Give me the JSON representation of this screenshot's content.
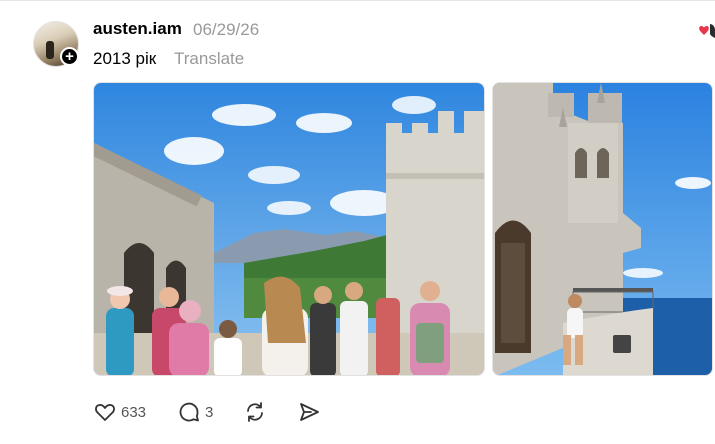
{
  "post": {
    "username": "austen.iam",
    "date": "06/29/26",
    "text": "2013 рік",
    "translate_label": "Translate",
    "follow_badge": "+"
  },
  "actions": {
    "likes": "633",
    "comments": "3"
  },
  "icons": {
    "like": "heart-icon",
    "comment": "comment-icon",
    "repost": "repost-icon",
    "share": "share-icon",
    "follow": "plus-icon",
    "top_right": "heart-reaction-icon"
  },
  "colors": {
    "secondary_text": "#999999",
    "reaction_red": "#e8364f"
  }
}
